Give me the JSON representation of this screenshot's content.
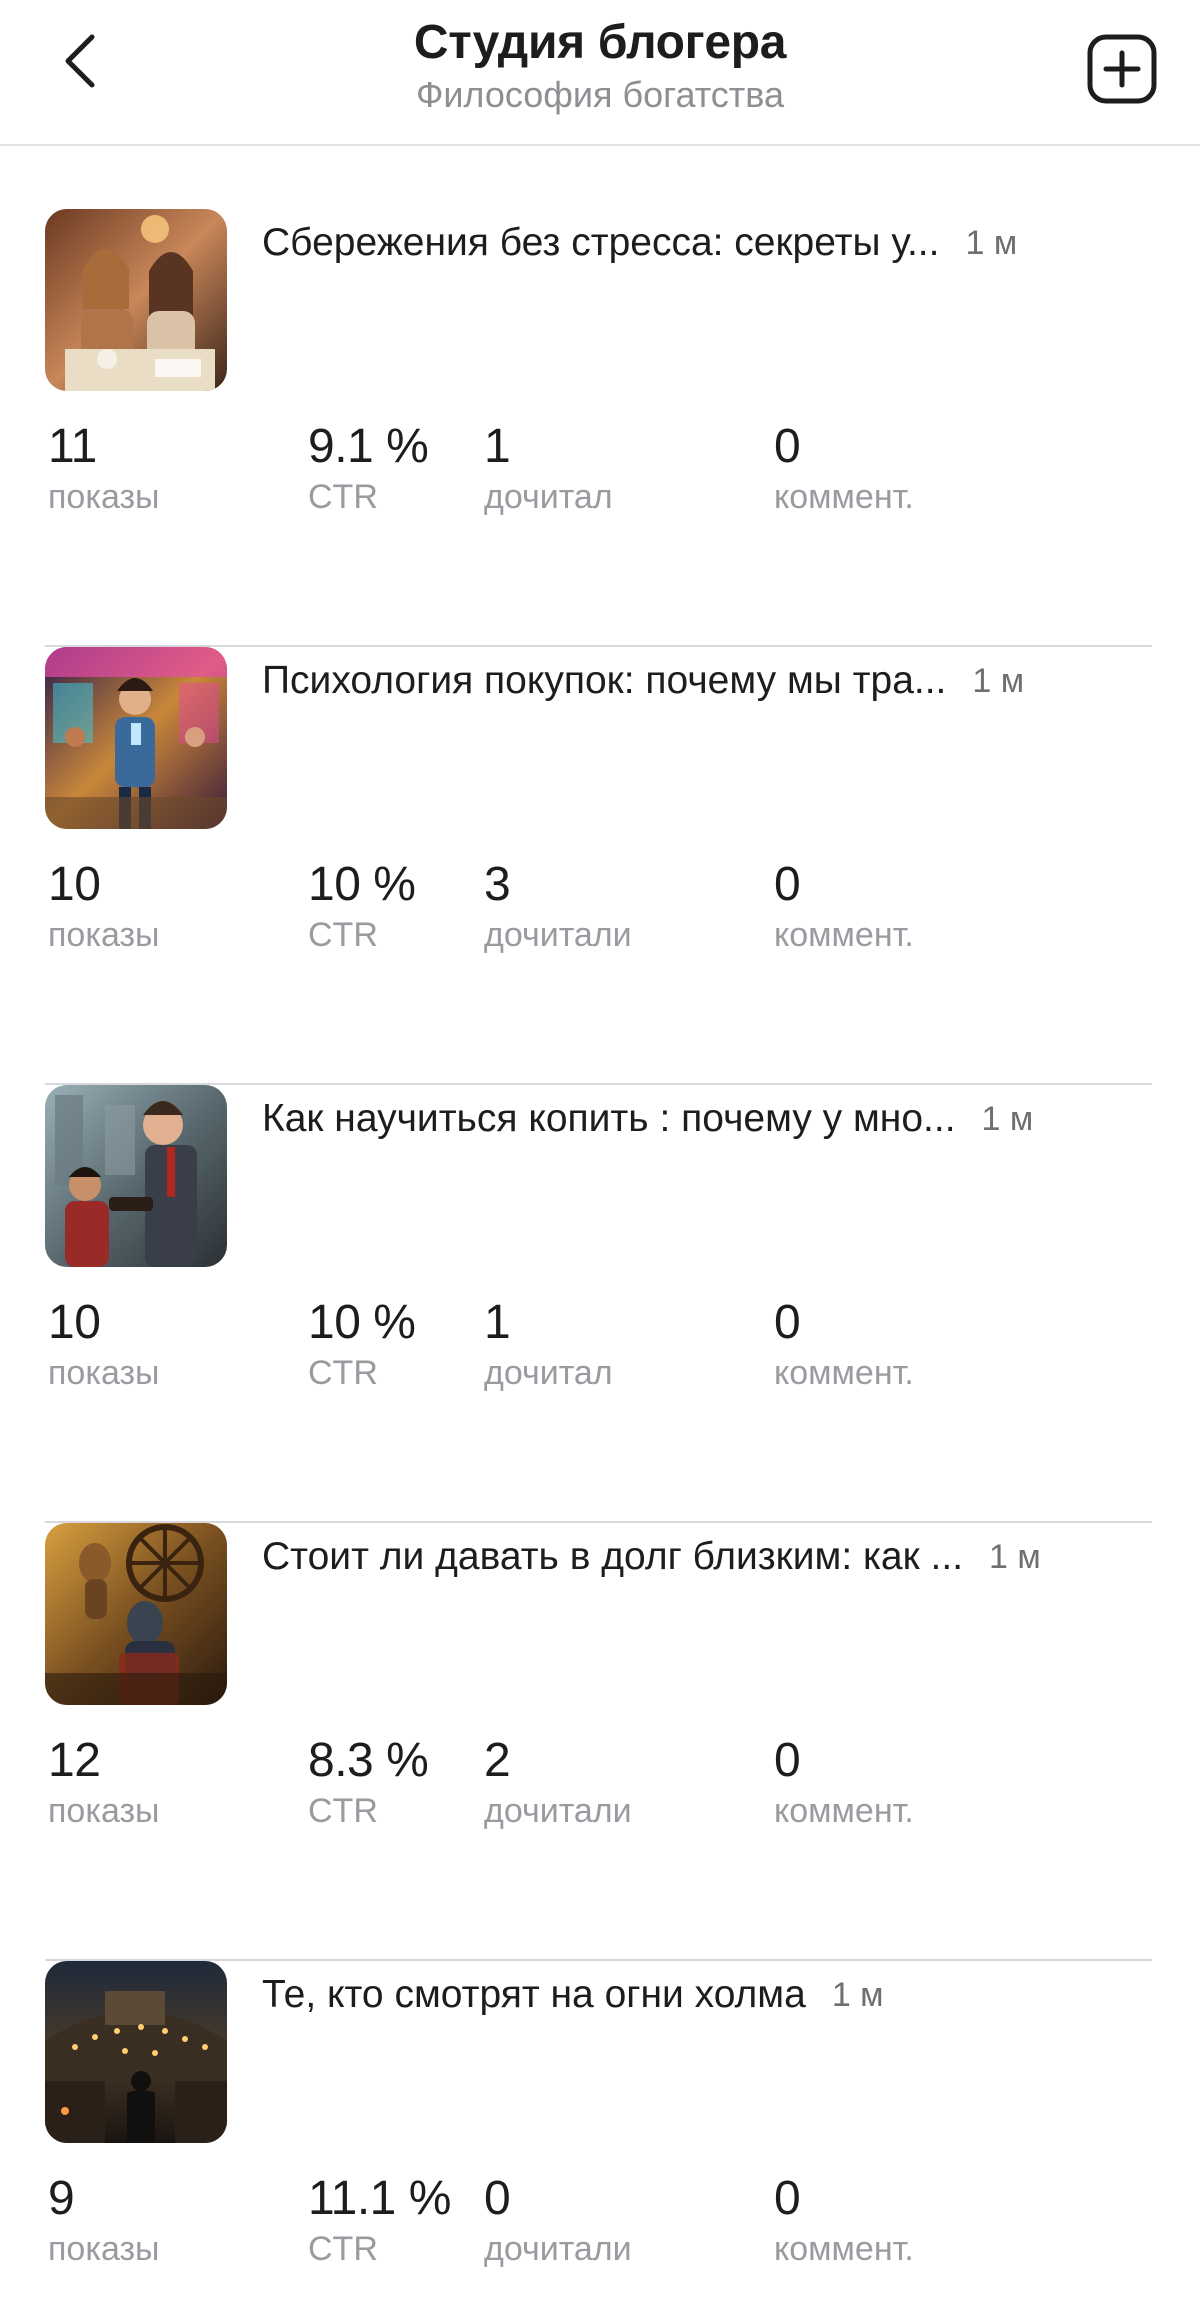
{
  "header": {
    "title": "Студия блогера",
    "subtitle": "Философия богатства",
    "back_icon": "chevron-left-icon",
    "add_icon": "plus-square-icon"
  },
  "articles": [
    {
      "title": "Сбережения без стресса: секреты у...",
      "time": "1 м",
      "stats": [
        {
          "value": "11",
          "label": "показы"
        },
        {
          "value": "9.1 %",
          "label": "CTR"
        },
        {
          "value": "1",
          "label": "дочитал"
        },
        {
          "value": "0",
          "label": "коммент."
        }
      ]
    },
    {
      "title": "Психология покупок: почему мы тра...",
      "time": "1 м",
      "stats": [
        {
          "value": "10",
          "label": "показы"
        },
        {
          "value": "10 %",
          "label": "CTR"
        },
        {
          "value": "3",
          "label": "дочитали"
        },
        {
          "value": "0",
          "label": "коммент."
        }
      ]
    },
    {
      "title": "Как научиться копить : почему у мно...",
      "time": "1 м",
      "stats": [
        {
          "value": "10",
          "label": "показы"
        },
        {
          "value": "10 %",
          "label": "CTR"
        },
        {
          "value": "1",
          "label": "дочитал"
        },
        {
          "value": "0",
          "label": "коммент."
        }
      ]
    },
    {
      "title": "Стоит ли давать в долг близким: как ...",
      "time": "1 м",
      "stats": [
        {
          "value": "12",
          "label": "показы"
        },
        {
          "value": "8.3 %",
          "label": "CTR"
        },
        {
          "value": "2",
          "label": "дочитали"
        },
        {
          "value": "0",
          "label": "коммент."
        }
      ]
    },
    {
      "title": "Те, кто смотрят на огни холма",
      "time": "1 м",
      "stats": [
        {
          "value": "9",
          "label": "показы"
        },
        {
          "value": "11.1 %",
          "label": "CTR"
        },
        {
          "value": "0",
          "label": "дочитали"
        },
        {
          "value": "0",
          "label": "коммент."
        }
      ]
    }
  ]
}
